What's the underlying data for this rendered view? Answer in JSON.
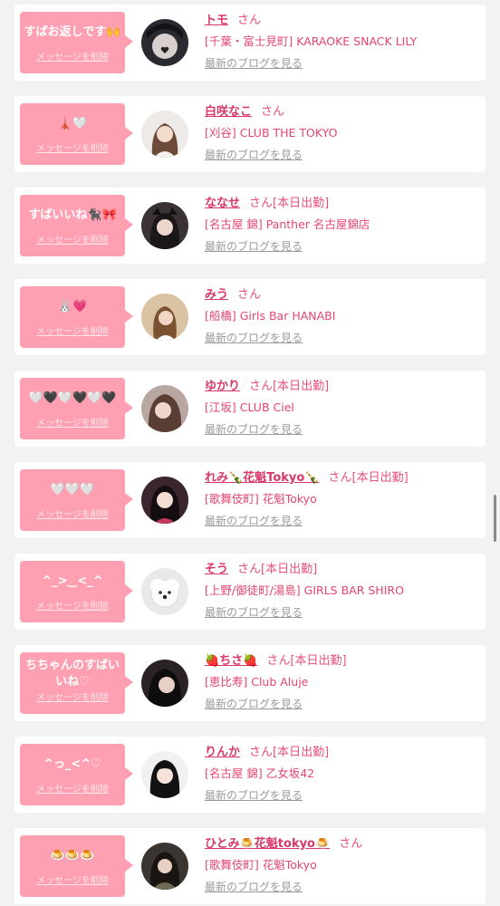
{
  "delete_label": "メッセージを削除",
  "blog_label": "最新のブログを見る",
  "san_label": "さん",
  "entries": [
    {
      "message": "すばお返しです🙌",
      "name": "トモ",
      "work_today": "",
      "shop": "[千葉・富士見町] KARAOKE SNACK LILY"
    },
    {
      "message": "🗼🤍",
      "name": "白咲なこ",
      "work_today": "",
      "shop": "[刈谷] CLUB THE TOKYO"
    },
    {
      "message": "すばいいね🐈‍⬛🎀",
      "name": "ななせ",
      "work_today": "[本日出勤]",
      "shop": "[名古屋 錦] Panther 名古屋錦店"
    },
    {
      "message": "🐰💗",
      "name": "みう",
      "work_today": "",
      "shop": "[船橋] Girls Bar HANABI"
    },
    {
      "message": "🤍🖤🤍🖤🤍🖤",
      "name": "ゆかり",
      "work_today": "[本日出勤]",
      "shop": "[江坂] CLUB Ciel"
    },
    {
      "message": "🤍🤍🤍",
      "name": "れみ🍾花魁Tokyo🍾",
      "work_today": "[本日出勤]",
      "shop": "[歌舞伎町] 花魁Tokyo"
    },
    {
      "message": "^_>‿<_^",
      "name": "そう",
      "work_today": "[本日出勤]",
      "shop": "[上野/御徒町/湯島] GIRLS BAR SHIRO"
    },
    {
      "message": "ちちゃんのすばいいね♡",
      "name": "🍓ちさ🍓",
      "work_today": "[本日出勤]",
      "shop": "[恵比寿] Club Aluje"
    },
    {
      "message": "^っ_<^♡",
      "name": "りんか",
      "work_today": "[本日出勤]",
      "shop": "[名古屋 錦] 乙女坂42"
    },
    {
      "message": "🍮🍮🍮",
      "name": "ひとみ🍮花魁tokyo🍮",
      "work_today": "",
      "shop": "[歌舞伎町] 花魁Tokyo"
    }
  ],
  "colors": {
    "bubble": "#ffa0b2",
    "name": "#d93868",
    "shop": "#e5456f",
    "blog_link": "#9a9a9a",
    "background": "#f2f2f2"
  }
}
